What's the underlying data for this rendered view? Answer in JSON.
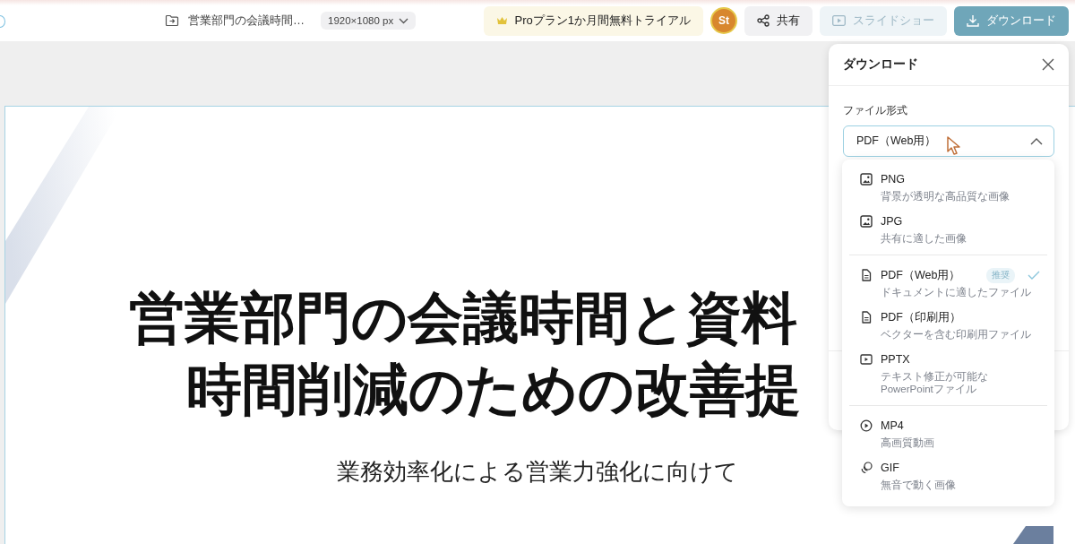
{
  "document": {
    "title": "営業部門の会議時間…",
    "size": "1920×1080 px"
  },
  "toolbar": {
    "trial_button": "Proプラン1か月間無料トライアル",
    "avatar": "St",
    "share_button": "共有",
    "slideshow_button": {
      "label": "スライドショー",
      "disabled": true
    },
    "download_button": "ダウンロード"
  },
  "slide": {
    "title_lines": [
      "営業部門の会議時間と資料",
      "時間削減のための改善提"
    ],
    "subtitle": "業務効率化による営業力強化に向けて"
  },
  "download_panel": {
    "title": "ダウンロード",
    "format_label": "ファイル形式",
    "format_select": {
      "value": "PDF（Web用）",
      "expanded": true
    }
  },
  "format_menu": {
    "groups": [
      {
        "items": [
          {
            "kind": "image",
            "label": "PNG",
            "description": "背景が透明な高品質な画像",
            "selected": false
          },
          {
            "kind": "image",
            "label": "JPG",
            "description": "共有に適した画像",
            "selected": false
          }
        ]
      },
      {
        "items": [
          {
            "kind": "document",
            "label": "PDF（Web用）",
            "description": "ドキュメントに適したファイル",
            "badge": "推奨",
            "selected": true
          },
          {
            "kind": "document",
            "label": "PDF（印刷用）",
            "description": "ベクターを含む印刷用ファイル",
            "selected": false
          },
          {
            "kind": "slides",
            "label": "PPTX",
            "description": "テキスト修正が可能なPowerPointファイル",
            "selected": false
          }
        ]
      },
      {
        "items": [
          {
            "kind": "video",
            "label": "MP4",
            "description": "高画質動画",
            "selected": false
          },
          {
            "kind": "gif",
            "label": "GIF",
            "description": "無音で動く画像",
            "selected": false
          }
        ]
      }
    ]
  }
}
